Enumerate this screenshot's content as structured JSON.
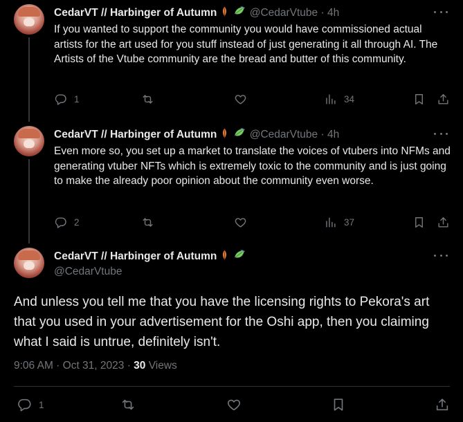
{
  "tweets": [
    {
      "name": "CedarVT // Harbinger of Autumn",
      "handle": "@CedarVtube",
      "time": "4h",
      "text": "If you wanted to support the community you would have commissioned actual artists for the art used for you stuff instead of just generating it all through AI. The Artists of the Vtube community are the bread and butter of this community.",
      "replies": "1",
      "views": "34"
    },
    {
      "name": "CedarVT // Harbinger of Autumn",
      "handle": "@CedarVtube",
      "time": "4h",
      "text": "Even more so, you set up a market to translate the voices of vtubers into NFMs and generating vtuber NFTs which is extremely toxic to the community and is just going to make the already poor opinion about the community even worse.",
      "replies": "2",
      "views": "37"
    }
  ],
  "main_tweet": {
    "name": "CedarVT // Harbinger of Autumn",
    "handle": "@CedarVtube",
    "text": "And unless you tell me that you have the licensing rights to Pekora's art that you used in your advertisement for the Oshi app, then you claiming what I said is untrue, definitely isn't.",
    "timestamp": "9:06 AM · Oct 31, 2023 · ",
    "views_count": "30",
    "views_label": " Views",
    "replies": "1"
  },
  "separator": " · ",
  "colors": {
    "background": "#000000",
    "text": "#e7e9ea",
    "muted": "#71767b",
    "divider": "#2f3336"
  },
  "icons": [
    "reply-icon",
    "retweet-icon",
    "like-icon",
    "views-icon",
    "bookmark-icon",
    "share-icon",
    "more-icon",
    "leaf-emoji-icon",
    "wind-leaf-emoji-icon"
  ]
}
